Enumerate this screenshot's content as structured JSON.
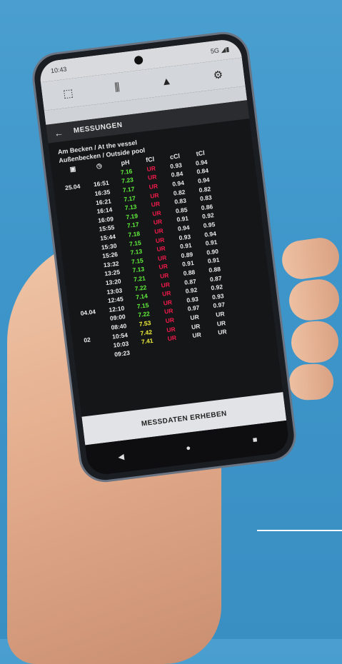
{
  "status": {
    "time": "10:43",
    "network": "5G ◢▮"
  },
  "toolbar": {
    "remote": "⬚",
    "wave": "⫼",
    "warning": "▲",
    "settings": "⚙"
  },
  "title": {
    "back": "←",
    "text": "MESSUNGEN"
  },
  "location": {
    "line1": "Am Becken / At the vessel",
    "line2": "Außenbecken / Outside pool"
  },
  "columns": {
    "date": "▣",
    "time": "◷",
    "ph": "pH",
    "fcl": "fCl",
    "ccl": "cCl",
    "tcl": "tCl"
  },
  "rows": [
    {
      "date": "",
      "time": "",
      "ph": "7.16",
      "ph_c": "g",
      "fcl": "UR",
      "ccl": "0.93",
      "tcl": "0.94"
    },
    {
      "date": "25.04",
      "time": "16:51",
      "ph": "7.23",
      "ph_c": "g",
      "fcl": "UR",
      "ccl": "0.84",
      "tcl": "0.84"
    },
    {
      "date": "",
      "time": "16:35",
      "ph": "7.17",
      "ph_c": "g",
      "fcl": "UR",
      "ccl": "0.94",
      "tcl": "0.94"
    },
    {
      "date": "",
      "time": "16:21",
      "ph": "7.17",
      "ph_c": "g",
      "fcl": "UR",
      "ccl": "0.82",
      "tcl": "0.82"
    },
    {
      "date": "",
      "time": "16:14",
      "ph": "7.13",
      "ph_c": "g",
      "fcl": "UR",
      "ccl": "0.83",
      "tcl": "0.83"
    },
    {
      "date": "",
      "time": "16:09",
      "ph": "7.19",
      "ph_c": "g",
      "fcl": "UR",
      "ccl": "0.85",
      "tcl": "0.86"
    },
    {
      "date": "",
      "time": "15:55",
      "ph": "7.17",
      "ph_c": "g",
      "fcl": "UR",
      "ccl": "0.91",
      "tcl": "0.92"
    },
    {
      "date": "",
      "time": "15:44",
      "ph": "7.18",
      "ph_c": "g",
      "fcl": "UR",
      "ccl": "0.94",
      "tcl": "0.95"
    },
    {
      "date": "",
      "time": "15:30",
      "ph": "7.15",
      "ph_c": "g",
      "fcl": "UR",
      "ccl": "0.93",
      "tcl": "0.94"
    },
    {
      "date": "",
      "time": "15:26",
      "ph": "7.13",
      "ph_c": "g",
      "fcl": "UR",
      "ccl": "0.91",
      "tcl": "0.91"
    },
    {
      "date": "",
      "time": "13:32",
      "ph": "7.15",
      "ph_c": "g",
      "fcl": "UR",
      "ccl": "0.89",
      "tcl": "0.90"
    },
    {
      "date": "",
      "time": "13:25",
      "ph": "7.13",
      "ph_c": "g",
      "fcl": "UR",
      "ccl": "0.91",
      "tcl": "0.91"
    },
    {
      "date": "",
      "time": "13:20",
      "ph": "7.21",
      "ph_c": "g",
      "fcl": "UR",
      "ccl": "0.88",
      "tcl": "0.88"
    },
    {
      "date": "",
      "time": "13:03",
      "ph": "7.22",
      "ph_c": "g",
      "fcl": "UR",
      "ccl": "0.87",
      "tcl": "0.87"
    },
    {
      "date": "",
      "time": "12:45",
      "ph": "7.14",
      "ph_c": "g",
      "fcl": "UR",
      "ccl": "0.92",
      "tcl": "0.92"
    },
    {
      "date": "04.04",
      "time": "12:10",
      "ph": "7.15",
      "ph_c": "g",
      "fcl": "UR",
      "ccl": "0.93",
      "tcl": "0.93"
    },
    {
      "date": "",
      "time": "09:00",
      "ph": "7.22",
      "ph_c": "g",
      "fcl": "UR",
      "ccl": "0.97",
      "tcl": "0.97"
    },
    {
      "date": "",
      "time": "08:40",
      "ph": "7.53",
      "ph_c": "y",
      "fcl": "UR",
      "ccl": "UR",
      "tcl": "UR"
    },
    {
      "date": "02",
      "time": "10:54",
      "ph": "7.42",
      "ph_c": "y",
      "fcl": "UR",
      "ccl": "UR",
      "tcl": "UR"
    },
    {
      "date": "",
      "time": "10:03",
      "ph": "7.41",
      "ph_c": "y",
      "fcl": "UR",
      "ccl": "UR",
      "tcl": "UR"
    },
    {
      "date": "",
      "time": "09:23",
      "ph": "",
      "ph_c": "g",
      "fcl": "",
      "ccl": "",
      "tcl": ""
    }
  ],
  "action": {
    "label": "MESSDATEN ERHEBEN"
  },
  "nav": {
    "back": "◀",
    "home": "●",
    "recent": "■"
  }
}
